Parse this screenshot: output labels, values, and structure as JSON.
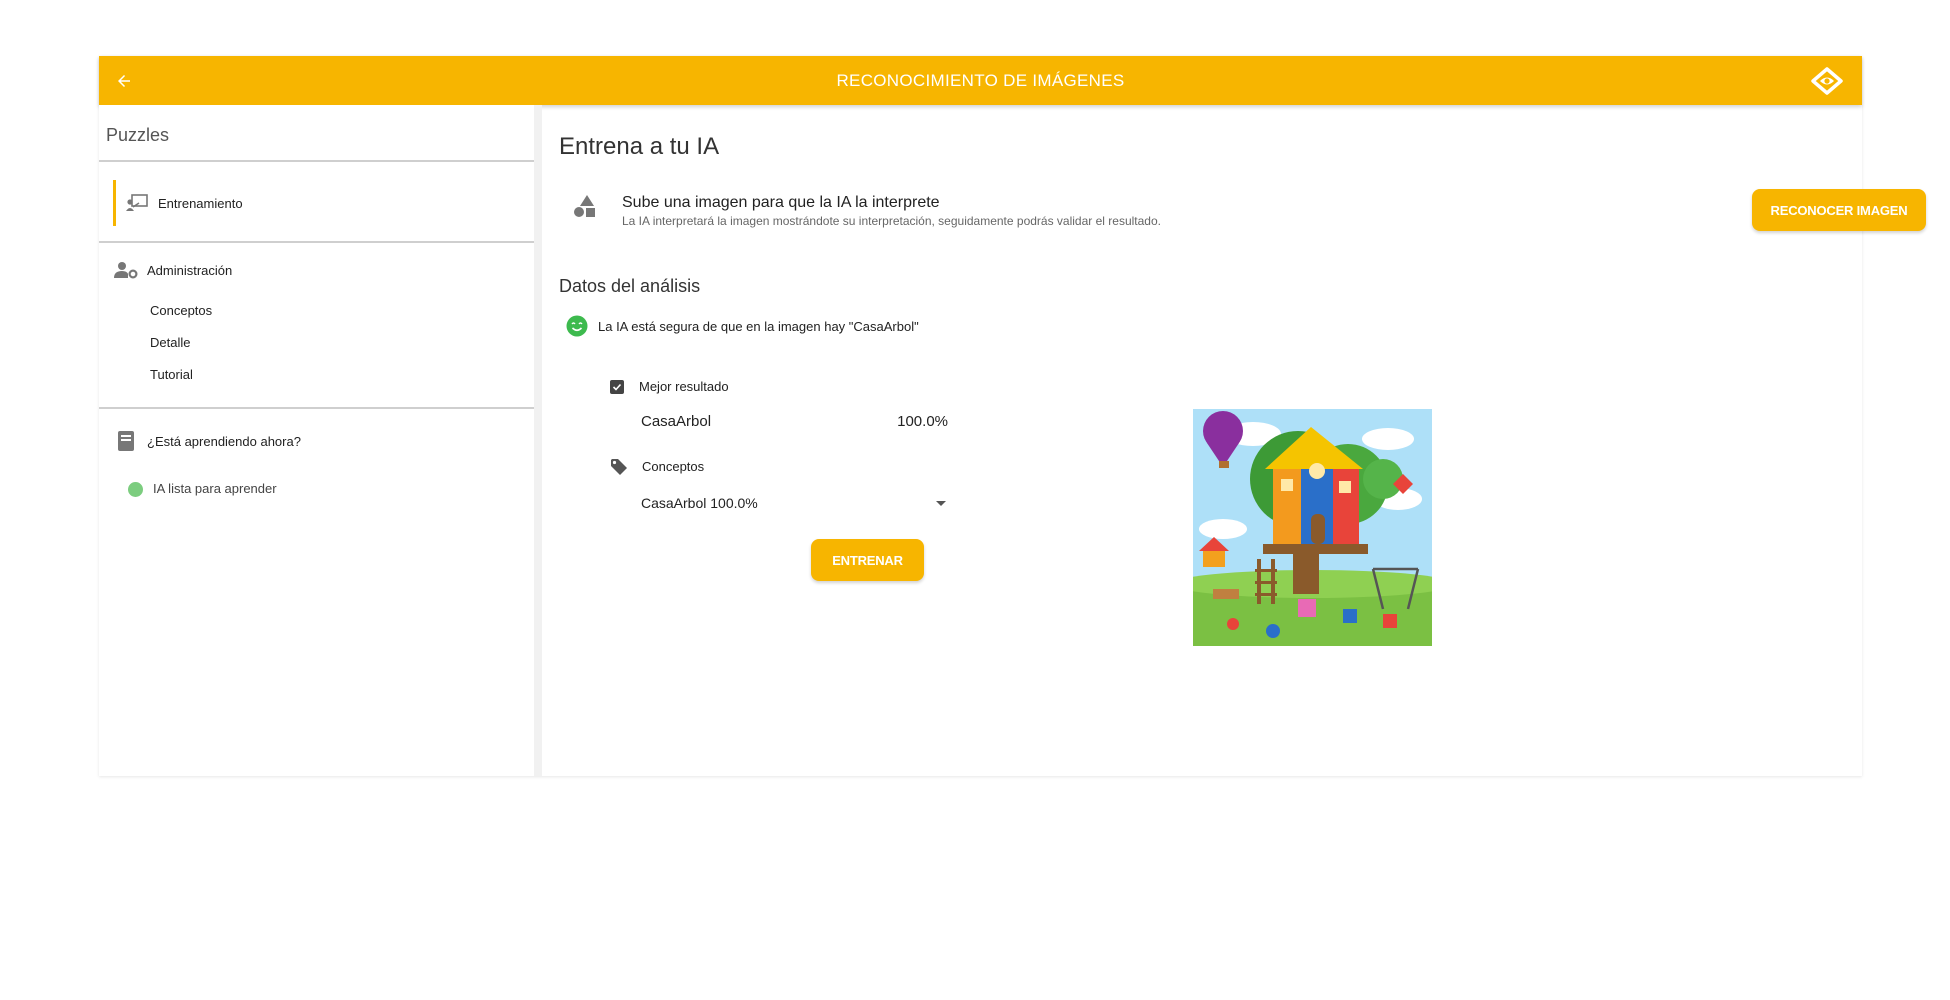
{
  "header": {
    "title": "RECONOCIMIENTO DE IMÁGENES",
    "back_icon": "arrow-left-icon",
    "logo_icon": "diamond-eye-logo-icon",
    "color": "#f7b500"
  },
  "sidebar": {
    "section_title": "Puzzles",
    "training_item": {
      "label": "Entrenamiento",
      "icon": "training-board-icon"
    },
    "admin_item": {
      "label": "Administración",
      "icon": "user-settings-icon"
    },
    "admin_subitems": [
      "Conceptos",
      "Detalle",
      "Tutorial"
    ],
    "learning_item": {
      "label": "¿Está aprendiendo ahora?",
      "icon": "book-icon"
    },
    "status": {
      "text": "IA lista para aprender",
      "color": "#7ccd7f"
    }
  },
  "main": {
    "title": "Entrena a tu IA",
    "upload": {
      "icon": "shapes-icon",
      "title": "Sube una imagen para que la IA la interprete",
      "subtitle": "La IA interpretará la imagen mostrándote su interpretación, seguidamente podrás validar el resultado."
    },
    "recognize_button": "RECONOCER IMAGEN",
    "analysis": {
      "title": "Datos del análisis",
      "message": "La IA está segura de que en la imagen hay \"CasaArbol\"",
      "message_icon": "smile-icon",
      "best_result_label": "Mejor resultado",
      "best_result_checked": true,
      "best_result_name": "CasaArbol",
      "best_result_value": "100.0%",
      "concepts_label": "Conceptos",
      "concepts_icon": "tag-icon",
      "concepts_selected": "CasaArbol 100.0%",
      "train_button": "ENTRENAR"
    },
    "image_icon": "treehouse-illustration"
  }
}
